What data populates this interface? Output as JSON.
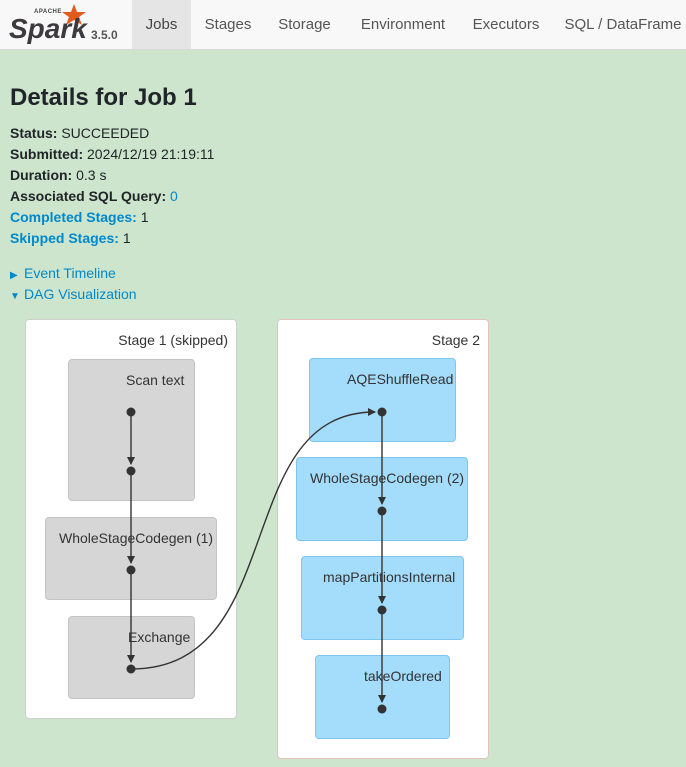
{
  "brand": {
    "apache": "APACHE",
    "name": "Spark",
    "version": "3.5.0"
  },
  "nav": {
    "tabs": [
      {
        "label": "Jobs",
        "active": true
      },
      {
        "label": "Stages",
        "active": false
      },
      {
        "label": "Storage",
        "active": false
      },
      {
        "label": "Environment",
        "active": false
      },
      {
        "label": "Executors",
        "active": false
      },
      {
        "label": "SQL / DataFrame",
        "active": false
      }
    ]
  },
  "page": {
    "title": "Details for Job 1"
  },
  "summary": {
    "status_label": "Status:",
    "status_value": "SUCCEEDED",
    "submitted_label": "Submitted:",
    "submitted_value": "2024/12/19 21:19:11",
    "duration_label": "Duration:",
    "duration_value": "0.3 s",
    "sql_label": "Associated SQL Query:",
    "sql_value": "0",
    "completed_label": "Completed Stages:",
    "completed_value": "1",
    "skipped_label": "Skipped Stages:",
    "skipped_value": "1"
  },
  "toggles": {
    "event_timeline": {
      "label": "Event Timeline",
      "expanded": false
    },
    "dag_visualization": {
      "label": "DAG Visualization",
      "expanded": true
    }
  },
  "dag": {
    "stage1": {
      "label": "Stage 1 (skipped)",
      "nodes": [
        "Scan text",
        "WholeStageCodegen (1)",
        "Exchange"
      ]
    },
    "stage2": {
      "label": "Stage 2",
      "nodes": [
        "AQEShuffleRead",
        "WholeStageCodegen (2)",
        "mapPartitionsInternal",
        "takeOrdered"
      ]
    }
  },
  "colors": {
    "background": "#cce5cc",
    "link": "#0088cc",
    "skipped_node": "#d6d6d6",
    "active_node": "#a4dcfb",
    "navbar": "#f8f8f8",
    "brand_orange": "#e25a1c"
  }
}
